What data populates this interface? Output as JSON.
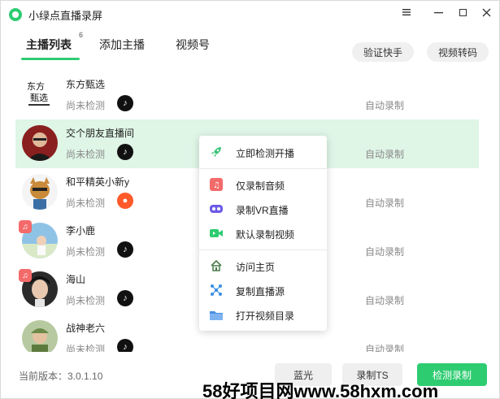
{
  "window": {
    "title": "小绿点直播录屏",
    "accent_color": "#2ecc71",
    "controls": [
      "menu-icon",
      "minimize-icon",
      "maximize-icon",
      "close-icon"
    ]
  },
  "tabs": [
    {
      "label": "主播列表",
      "badge": "6",
      "active": true
    },
    {
      "label": "添加主播",
      "active": false
    },
    {
      "label": "视频号",
      "active": false
    }
  ],
  "top_buttons": {
    "verify_kuaishou": "验证快手",
    "video_convert": "视频转码"
  },
  "streamers": [
    {
      "name": "东方甄选",
      "status": "尚未检测",
      "mode": "自动录制",
      "platform": "douyin-icon",
      "audio_only": false,
      "selected": false
    },
    {
      "name": "交个朋友直播间",
      "status": "尚未检测",
      "mode": "自动录制",
      "platform": "douyin-icon",
      "audio_only": false,
      "selected": true
    },
    {
      "name": "和平精英小新y",
      "status": "尚未检测",
      "mode": "自动录制",
      "platform": "kuaishou-icon",
      "audio_only": false,
      "selected": false
    },
    {
      "name": "李小鹿",
      "status": "尚未检测",
      "mode": "自动录制",
      "platform": "douyin-icon",
      "audio_only": true,
      "selected": false
    },
    {
      "name": "海山",
      "status": "尚未检测",
      "mode": "自动录制",
      "platform": "douyin-icon",
      "audio_only": true,
      "selected": false
    },
    {
      "name": "战神老六",
      "status": "尚未检测",
      "mode": "自动录制",
      "platform": "douyin-icon",
      "audio_only": false,
      "selected": false
    }
  ],
  "context_menu": {
    "items": [
      {
        "label": "立即检测开播",
        "icon": "rocket-icon",
        "color": "#3cc47c"
      },
      {
        "label": "仅录制音频",
        "icon": "music-icon",
        "color": "#f46a6a"
      },
      {
        "label": "录制VR直播",
        "icon": "vr-icon",
        "color": "#6c5ce7"
      },
      {
        "label": "默认录制视频",
        "icon": "video-icon",
        "color": "#2ecc71"
      },
      {
        "label": "访问主页",
        "icon": "home-icon",
        "color": "#4a7a4a"
      },
      {
        "label": "复制直播源",
        "icon": "share-nodes-icon",
        "color": "#3b8fe6"
      },
      {
        "label": "打开视频目录",
        "icon": "folder-icon",
        "color": "#4a90e2"
      }
    ]
  },
  "footer": {
    "version": "当前版本：3.0.1.10",
    "btn_bluray": "蓝光",
    "btn_record_ts": "录制TS",
    "btn_detect_record": "检测录制"
  },
  "watermark": "58好项目网www.58hxm.com"
}
